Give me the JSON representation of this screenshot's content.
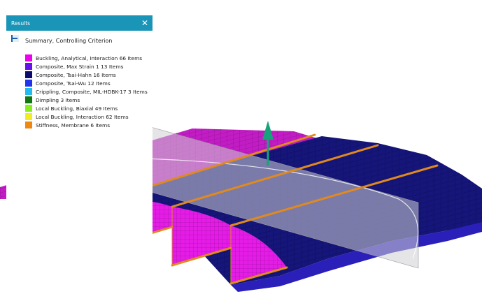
{
  "results_panel": {
    "title": "Results",
    "close_icon": "close-icon",
    "summary_label": "Summary, Controlling Criterion",
    "legend": [
      {
        "label": "Buckling, Analytical, Interaction 66 Items",
        "color": "#ee00ee"
      },
      {
        "label": "Composite, Max Strain 1 13 Items",
        "color": "#6611ee"
      },
      {
        "label": "Composite, Tsai-Hahn 16 Items",
        "color": "#0b0b6e"
      },
      {
        "label": "Composite, Tsai-Wu 12 Items",
        "color": "#2233ee"
      },
      {
        "label": "Crippling, Composite, MIL-HDBK-17 3 Items",
        "color": "#22bbee"
      },
      {
        "label": "Dimpling 3 Items",
        "color": "#117711"
      },
      {
        "label": "Local Buckling, Biaxial 49 Items",
        "color": "#88ee22"
      },
      {
        "label": "Local Buckling, Interaction 62 Items",
        "color": "#eeee22"
      },
      {
        "label": "Stiffness, Membrane 6 Items",
        "color": "#ee8811"
      }
    ]
  },
  "model_colors": {
    "magenta_panel": "#c21cc4",
    "navy_panel": "#14146e",
    "blue_edge": "#2a1fb8",
    "stiffener": "#e08a1e",
    "arrow": "#15a37a"
  }
}
